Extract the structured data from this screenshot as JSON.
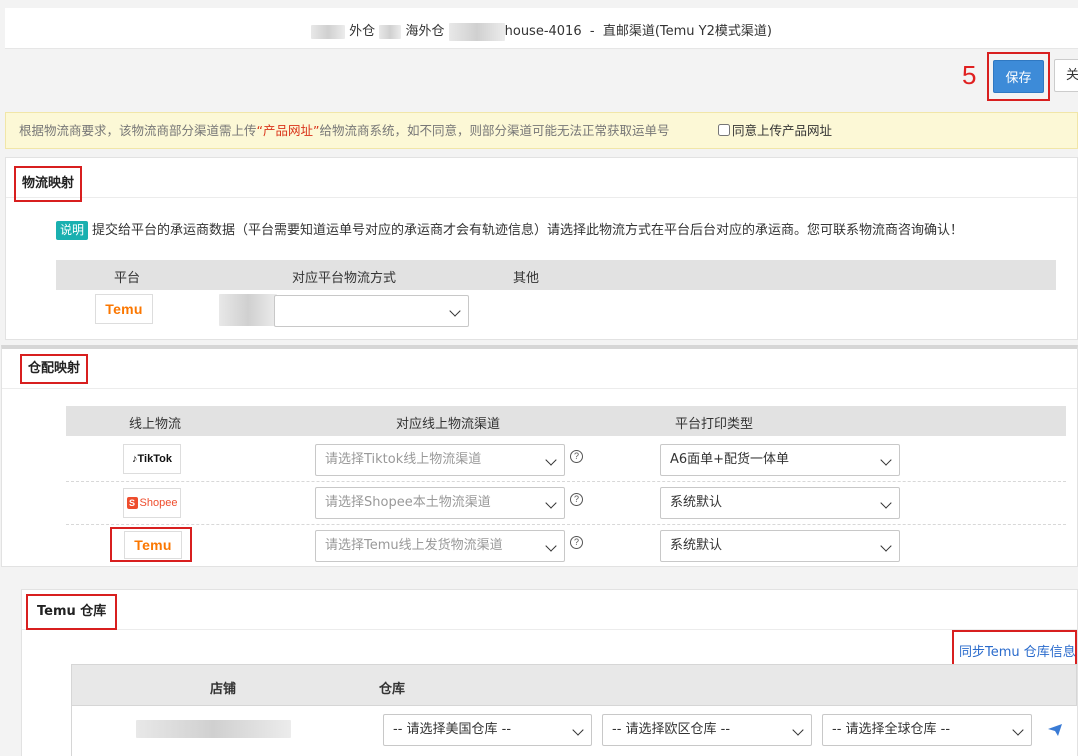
{
  "header": {
    "title_part1": "外仓",
    "title_part2": "海外仓",
    "title_part3": "house-4016",
    "title_sep": "-",
    "title_channel": "直邮渠道(Temu Y2模式渠道)"
  },
  "toolbar": {
    "step_number": "5",
    "save_label": "保存",
    "close_label": "关"
  },
  "notice": {
    "text_before": "根据物流商要求，该物流商部分渠道需上传",
    "highlight": "“产品网址”",
    "text_after": "给物流商系统，如不同意，则部分渠道可能无法正常获取运单号",
    "checkbox_label": "同意上传产品网址"
  },
  "logistics_mapping": {
    "title": "物流映射",
    "explain_tag": "说明",
    "explain_text": "提交给平台的承运商数据（平台需要知道运单号对应的承运商才会有轨迹信息）请选择此物流方式在平台后台对应的承运商。您可联系物流商咨询确认！",
    "columns": [
      "平台",
      "对应平台物流方式",
      "其他"
    ],
    "row_platform": "Temu"
  },
  "warehouse_mapping": {
    "title": "仓配映射",
    "columns": [
      "线上物流",
      "对应线上物流渠道",
      "平台打印类型"
    ],
    "rows": [
      {
        "platform": "TikTok",
        "channel_placeholder": "请选择Tiktok线上物流渠道",
        "print_type": "A6面单+配货一体单"
      },
      {
        "platform": "Shopee",
        "channel_placeholder": "请选择Shopee本土物流渠道",
        "print_type": "系统默认"
      },
      {
        "platform": "Temu",
        "channel_placeholder": "请选择Temu线上发货物流渠道",
        "print_type": "系统默认"
      }
    ],
    "help_glyph": "?"
  },
  "temu_warehouse": {
    "title": "Temu 仓库",
    "sync_link": "同步Temu 仓库信息",
    "columns": [
      "店铺",
      "仓库"
    ],
    "selects": [
      "-- 请选择美国仓库 --",
      "-- 请选择欧区仓库 --",
      "-- 请选择全球仓库 --"
    ]
  },
  "colors": {
    "primary": "#3d8bd8",
    "annotation_red": "#d81f1f",
    "temu_orange": "#fb7701",
    "link_blue": "#2a6bcc"
  }
}
